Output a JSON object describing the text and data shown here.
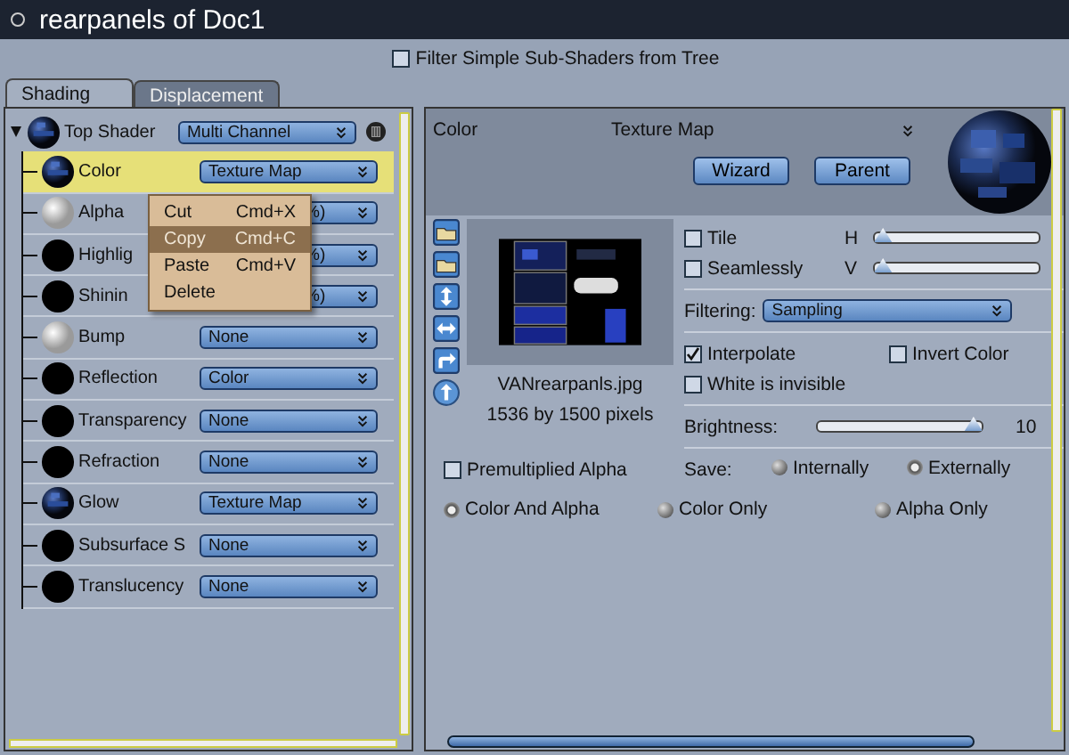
{
  "window": {
    "title": "rearpanels of Doc1"
  },
  "filter": {
    "label": "Filter Simple Sub-Shaders from Tree",
    "checked": false
  },
  "tabs": [
    {
      "label": "Shading",
      "selected": true
    },
    {
      "label": "Displacement",
      "selected": false
    }
  ],
  "tree": {
    "label": "Top Shader",
    "expanded": true,
    "kind": "texture",
    "value": "Multi Channel",
    "children": [
      {
        "label": "Color",
        "kind": "texture",
        "value": "Texture Map",
        "selected": true,
        "covered": false
      },
      {
        "label": "Alpha",
        "kind": "white",
        "value": "%)",
        "selected": false,
        "covered": true
      },
      {
        "label": "Highlig",
        "kind": "black",
        "value": "%)",
        "selected": false,
        "covered": true
      },
      {
        "label": "Shinin",
        "kind": "black",
        "value": "%)",
        "selected": false,
        "covered": true
      },
      {
        "label": "Bump",
        "kind": "white",
        "value": "None",
        "selected": false,
        "covered": false
      },
      {
        "label": "Reflection",
        "kind": "black",
        "value": "Color",
        "selected": false,
        "covered": false
      },
      {
        "label": "Transparency",
        "kind": "black",
        "value": "None",
        "selected": false,
        "covered": false
      },
      {
        "label": "Refraction",
        "kind": "black",
        "value": "None",
        "selected": false,
        "covered": false
      },
      {
        "label": "Glow",
        "kind": "texture",
        "value": "Texture Map",
        "selected": false,
        "covered": false
      },
      {
        "label": "Subsurface S",
        "kind": "black",
        "value": "None",
        "selected": false,
        "covered": false
      },
      {
        "label": "Translucency",
        "kind": "black",
        "value": "None",
        "selected": false,
        "covered": false
      }
    ]
  },
  "context_menu": [
    {
      "label": "Cut",
      "shortcut": "Cmd+X",
      "selected": false
    },
    {
      "label": "Copy",
      "shortcut": "Cmd+C",
      "selected": true
    },
    {
      "label": "Paste",
      "shortcut": "Cmd+V",
      "selected": false
    },
    {
      "label": "Delete",
      "selected": false
    }
  ],
  "editor": {
    "channel": "Color",
    "type": "Texture Map",
    "buttons": [
      "Wizard",
      "Parent"
    ],
    "file_name": "VANrearpanls.jpg",
    "dimensions": "1536 by 1500 pixels",
    "tile": {
      "label": "Tile",
      "checked": false,
      "axis": "H",
      "level": 0.05
    },
    "seamless": {
      "label": "Seamlessly",
      "checked": false,
      "axis": "V",
      "level": 0.05
    },
    "filtering": {
      "label": "Filtering:",
      "value": "Sampling"
    },
    "options": [
      {
        "label": "Interpolate",
        "checked": true
      },
      {
        "label": "Invert Color",
        "checked": false
      },
      {
        "label": "White is invisible",
        "checked": false
      }
    ],
    "brightness": {
      "label": "Brightness:",
      "level": 0.95,
      "reading": "10"
    },
    "save": {
      "label": "Save:",
      "choices": [
        {
          "label": "Internally",
          "selected": false
        },
        {
          "label": "Externally",
          "selected": true
        }
      ]
    },
    "premultiplied": {
      "label": "Premultiplied Alpha",
      "checked": false
    },
    "channels": [
      {
        "label": "Color And Alpha",
        "selected": true
      },
      {
        "label": "Color Only",
        "selected": false
      },
      {
        "label": "Alpha Only",
        "selected": false
      }
    ]
  }
}
